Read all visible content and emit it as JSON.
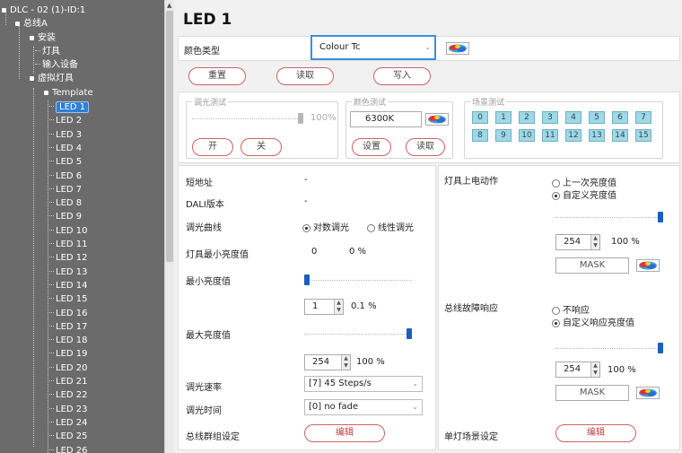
{
  "tree": {
    "root": "DLC - 02 (1)-ID:1",
    "bus": "总线A",
    "install": "安装",
    "fixture": "灯具",
    "input": "输入设备",
    "virtual": "虚拟灯具",
    "template": "Template",
    "leds": [
      "LED 1",
      "LED 2",
      "LED 3",
      "LED 4",
      "LED 5",
      "LED 6",
      "LED 7",
      "LED 8",
      "LED 9",
      "LED 10",
      "LED 11",
      "LED 12",
      "LED 13",
      "LED 14",
      "LED 15",
      "LED 16",
      "LED 17",
      "LED 18",
      "LED 19",
      "LED 20",
      "LED 21",
      "LED 22",
      "LED 23",
      "LED 24",
      "LED 25",
      "LED 26"
    ]
  },
  "header": {
    "title": "LED 1",
    "color_type_label": "颜色类型",
    "color_type_value": "Colour Tc"
  },
  "actions": {
    "reset": "重置",
    "read": "读取",
    "write": "写入"
  },
  "dim_test": {
    "legend": "调光测试",
    "percent": "100%",
    "on": "开",
    "off": "关"
  },
  "color_test": {
    "legend": "颜色测试",
    "value": "6300K",
    "set": "设置",
    "read": "读取"
  },
  "scene_test": {
    "legend": "场景测试",
    "cells": [
      "0",
      "1",
      "2",
      "3",
      "4",
      "5",
      "6",
      "7",
      "8",
      "9",
      "10",
      "11",
      "12",
      "13",
      "14",
      "15"
    ]
  },
  "left": {
    "short_addr_label": "短地址",
    "short_addr_value": "-",
    "dali_label": "DALI版本",
    "dali_value": "-",
    "curve_label": "调光曲线",
    "curve_log": "对数调光",
    "curve_lin": "线性调光",
    "min_bright_label": "灯具最小亮度值",
    "min_bright_value": "0",
    "min_bright_pct": "0 %",
    "min_level_label": "最小亮度值",
    "min_level_value": "1",
    "min_level_pct": "0.1 %",
    "min_level_fraction": 0.0,
    "max_level_label": "最大亮度值",
    "max_level_value": "254",
    "max_level_pct": "100 %",
    "max_level_fraction": 1.0,
    "fade_rate_label": "调光速率",
    "fade_rate_value": "[7] 45 Steps/s",
    "fade_time_label": "调光时间",
    "fade_time_value": "[0] no fade",
    "group_label": "总线群组设定",
    "group_edit": "编辑"
  },
  "right": {
    "power_on_label": "灯具上电动作",
    "power_last": "上一次亮度值",
    "power_custom": "自定义亮度值",
    "power_value": "254",
    "power_pct": "100 %",
    "power_mask": "MASK",
    "power_fraction": 1.0,
    "failure_label": "总线故障响应",
    "failure_none": "不响应",
    "failure_custom": "自定义响应亮度值",
    "failure_value": "254",
    "failure_pct": "100 %",
    "failure_mask": "MASK",
    "failure_fraction": 1.0,
    "scene_label": "单灯场景设定",
    "scene_edit": "编辑"
  },
  "icons": [
    "color-wheel-icon",
    "tree-bullet-icon",
    "chevron-down-icon",
    "spin-arrows-icon"
  ],
  "colors": {
    "accent_border": "#3b8ee0",
    "button_border": "#d06060",
    "slider": "#1a5fc0",
    "tree_bg": "#6b6b6b",
    "scene_cell": "#9fd8e6"
  }
}
